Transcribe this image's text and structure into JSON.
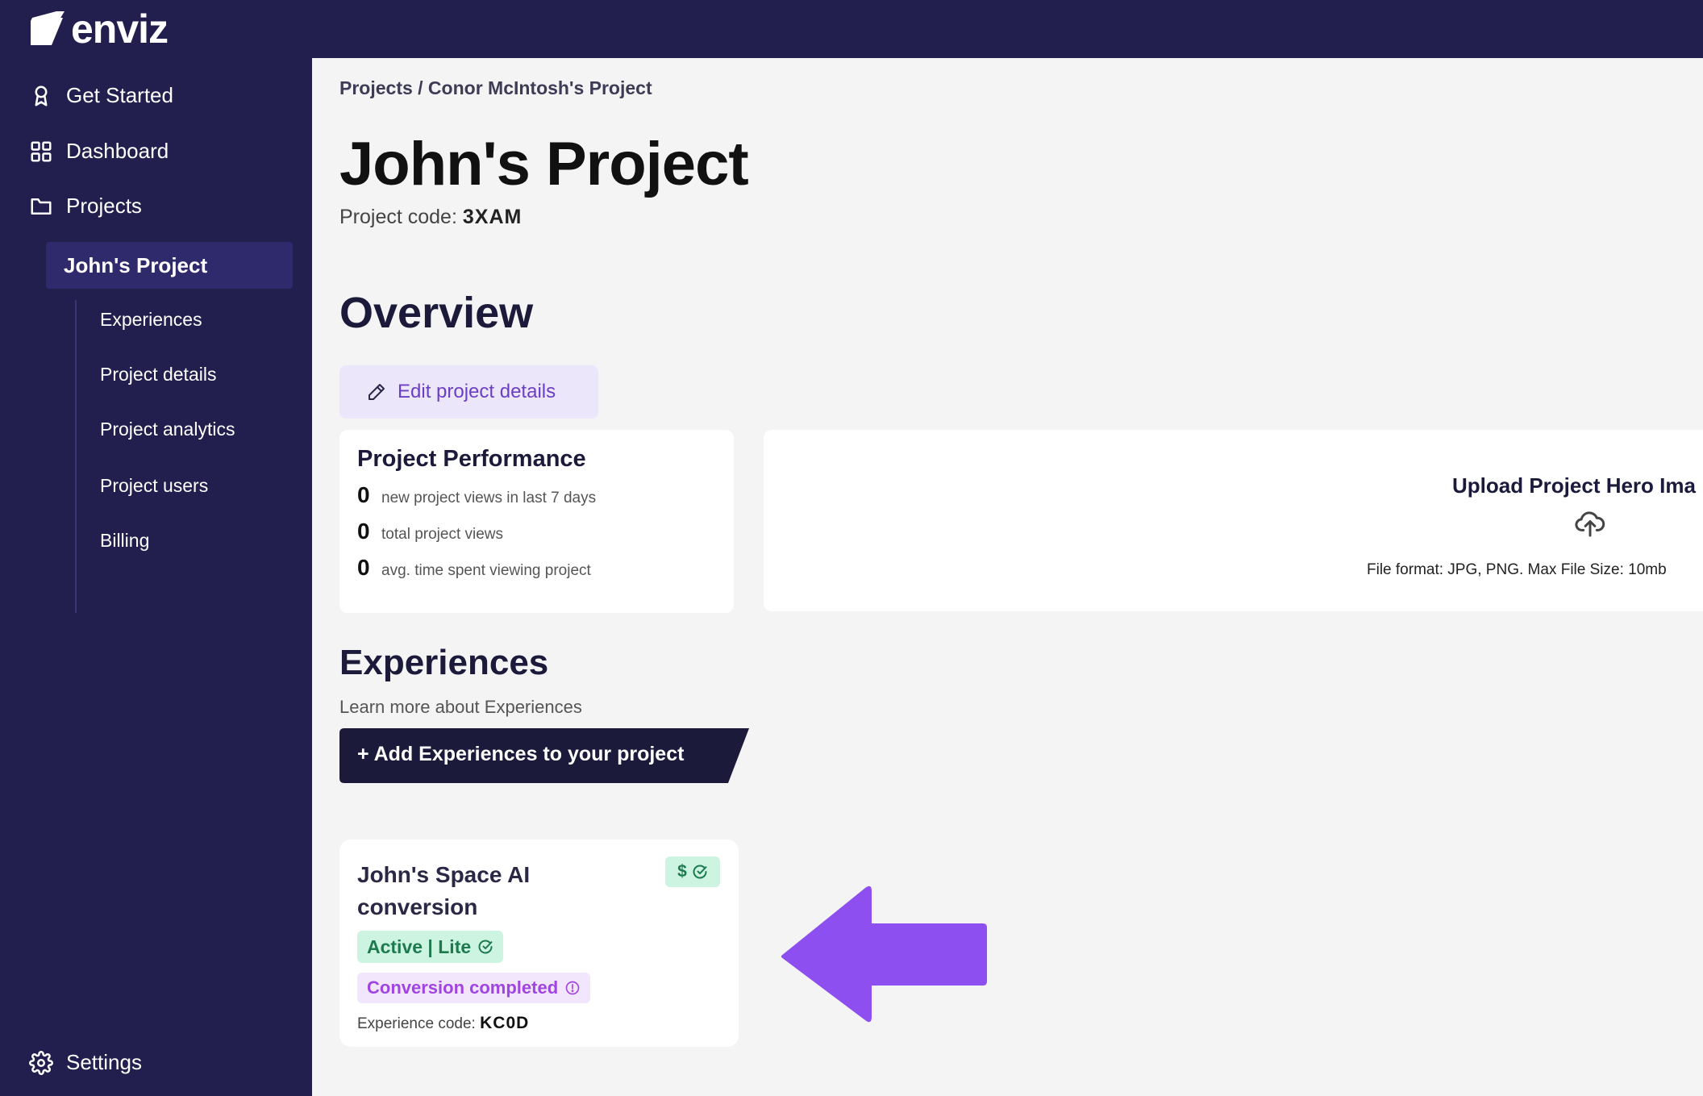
{
  "brand": {
    "name": "enviz"
  },
  "sidebar": {
    "items": [
      {
        "label": "Get Started",
        "icon": "award-icon"
      },
      {
        "label": "Dashboard",
        "icon": "grid-icon"
      },
      {
        "label": "Projects",
        "icon": "folder-icon"
      }
    ],
    "active_project": "John's Project",
    "sub_items": [
      "Experiences",
      "Project details",
      "Project analytics",
      "Project users",
      "Billing"
    ],
    "settings_label": "Settings"
  },
  "breadcrumb": "Projects / Conor McIntosh's Project",
  "page": {
    "title": "John's Project",
    "code_label": "Project code:",
    "code_value": "3XAM"
  },
  "overview": {
    "heading": "Overview",
    "edit_label": "Edit project details"
  },
  "performance": {
    "title": "Project Performance",
    "stats": [
      {
        "value": "0",
        "label": "new project views in last 7 days"
      },
      {
        "value": "0",
        "label": "total project views"
      },
      {
        "value": "0",
        "label": "avg. time spent viewing project"
      }
    ]
  },
  "upload": {
    "title": "Upload Project Hero Ima",
    "hint": "File format: JPG, PNG. Max File Size: 10mb"
  },
  "experiences": {
    "heading": "Experiences",
    "learn_more": "Learn more about Experiences",
    "add_label": "+ Add Experiences to your project",
    "card": {
      "title": "John's Space AI conversion",
      "paid_badge": "$",
      "status": "Active | Lite",
      "conversion": "Conversion completed",
      "code_label": "Experience code:",
      "code_value": "KC0D"
    }
  },
  "colors": {
    "sidebar_bg": "#221f4e",
    "active_item_bg": "#2f2a6b",
    "accent_purple": "#8e4ff0",
    "success_green": "#1d7a4e",
    "success_bg": "#cdf4e1"
  }
}
